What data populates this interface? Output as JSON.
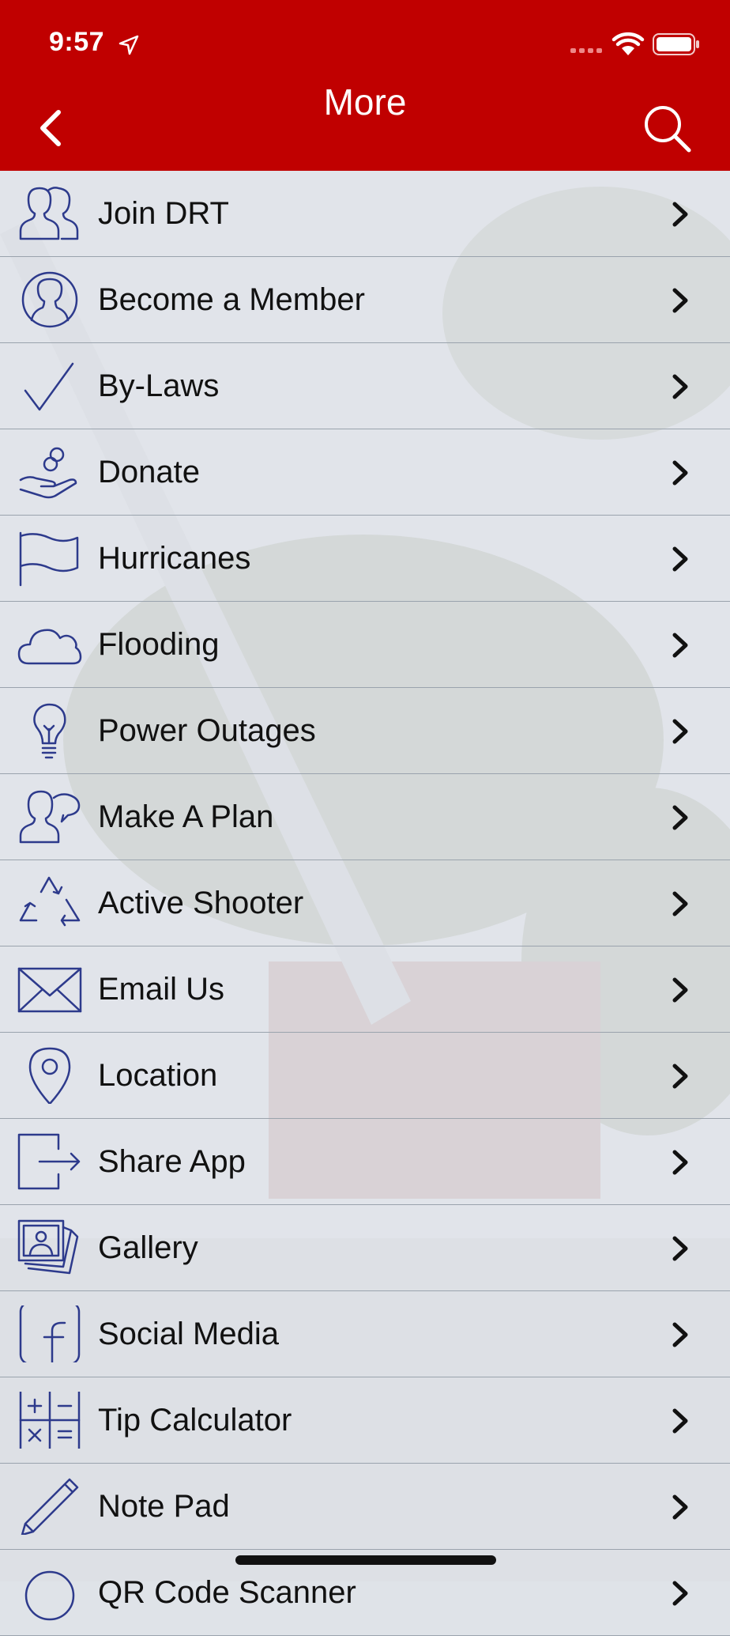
{
  "status_bar": {
    "time": "9:57"
  },
  "header": {
    "title": "More"
  },
  "menu": [
    {
      "label": "Join DRT",
      "icon": "group-icon"
    },
    {
      "label": "Become a Member",
      "icon": "person-icon"
    },
    {
      "label": "By-Laws",
      "icon": "checkmark-icon"
    },
    {
      "label": "Donate",
      "icon": "hand-coins-icon"
    },
    {
      "label": "Hurricanes",
      "icon": "flag-icon"
    },
    {
      "label": "Flooding",
      "icon": "cloud-icon"
    },
    {
      "label": "Power Outages",
      "icon": "lightbulb-icon"
    },
    {
      "label": "Make A Plan",
      "icon": "chat-person-icon"
    },
    {
      "label": "Active Shooter",
      "icon": "recycle-icon"
    },
    {
      "label": "Email Us",
      "icon": "envelope-icon"
    },
    {
      "label": "Location",
      "icon": "map-pin-icon"
    },
    {
      "label": "Share App",
      "icon": "share-exit-icon"
    },
    {
      "label": "Gallery",
      "icon": "photo-stack-icon"
    },
    {
      "label": "Social Media",
      "icon": "facebook-icon"
    },
    {
      "label": "Tip Calculator",
      "icon": "calculator-icon"
    },
    {
      "label": "Note Pad",
      "icon": "pencil-icon"
    },
    {
      "label": "QR Code Scanner",
      "icon": "qr-scanner-icon"
    }
  ],
  "colors": {
    "header": "#c00000",
    "icon_stroke": "#2d3a8c",
    "text": "#111111"
  }
}
